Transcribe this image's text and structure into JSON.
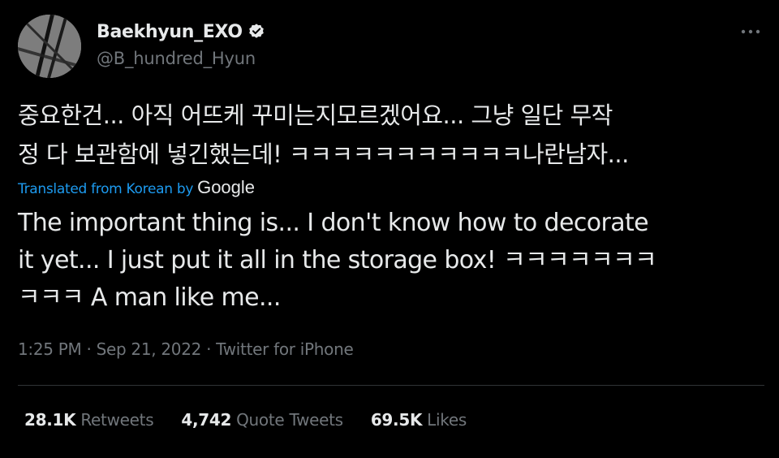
{
  "user": {
    "display_name": "Baekhyun_EXO",
    "handle": "@B_hundred_Hyun",
    "verified_icon": "verified-badge-icon",
    "avatar_icon": "avatar-image"
  },
  "tweet": {
    "korean_text": "중요한건... 아직 어뜨케 꾸미는지모르겠어요... 그냥 일단 무작\n정 다 보관함에 넣긴했는데! ㅋㅋㅋㅋㅋㅋㅋㅋㅋㅋㅋ나란남자...",
    "translation_prefix": "Translated from Korean by",
    "translation_provider": "Google",
    "english_text": "The important thing is... I don't know how to decorate\nit yet... I just put it all in the storage box! ㅋㅋㅋㅋㅋㅋㅋ\nㅋㅋㅋ A man like me..."
  },
  "meta": {
    "time": "1:25 PM",
    "separator": "·",
    "date": "Sep 21, 2022",
    "source": "Twitter for iPhone"
  },
  "stats": {
    "retweets_count": "28.1K",
    "retweets_label": "Retweets",
    "quotes_count": "4,742",
    "quotes_label": "Quote Tweets",
    "likes_count": "69.5K",
    "likes_label": "Likes"
  },
  "colors": {
    "background": "#000000",
    "primary_text": "#e7e9ea",
    "secondary_text": "#71767b",
    "link_blue": "#1d9bf0",
    "divider": "#2f3336"
  },
  "icons": {
    "more": "more-options-icon"
  }
}
